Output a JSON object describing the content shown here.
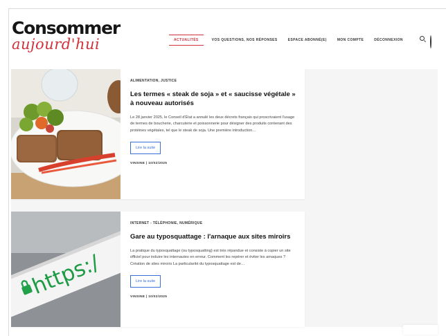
{
  "site": {
    "logo_top": "Consommer",
    "logo_bottom": "aujourd'hui",
    "accent_color": "#d0313b",
    "link_color": "#3a6fd8"
  },
  "nav": {
    "items": [
      {
        "label": "Actualités",
        "active": true
      },
      {
        "label": "Vos questions, nos réponses",
        "active": false
      },
      {
        "label": "Espace abonné(e)",
        "active": false
      },
      {
        "label": "Mon compte",
        "active": false
      },
      {
        "label": "Déconnexion",
        "active": false
      }
    ],
    "icons": [
      "search-icon",
      "account-icon"
    ]
  },
  "articles": [
    {
      "category": "Alimentation, Justice",
      "title": "Les termes « steak de soja » et « saucisse végétale » à nouveau autorisés",
      "excerpt": "Le 28 janvier 2025, le Conseil d'État a annulé les deux décrets français qui proscrivaient l'usage de termes de boucherie, charcuterie et poissonnerie pour désigner des produits contenant des protéines végétales, tel que le steak de soja. Une première introduction…",
      "button_label": "Lire la suite",
      "meta": "VINSINE  |  10/02/2025",
      "image": "plate-of-veggie-steaks"
    },
    {
      "category": "Internet - Téléphonie, Numérique",
      "title": "Gare au typosquattage : l'arnaque aux sites miroirs",
      "excerpt": "La pratique du typosquattage (ou typosquatting) est très répandue et consiste à copier un site officiel pour induire les internautes en erreur. Comment les repérer et éviter les arnaques ? Création de sites miroirs La particularité du typosquattage est de…",
      "button_label": "Lire la suite",
      "meta": "VINSINE  |  10/02/2025",
      "image": "https-lock-address-bar",
      "image_text": "https:/"
    }
  ]
}
